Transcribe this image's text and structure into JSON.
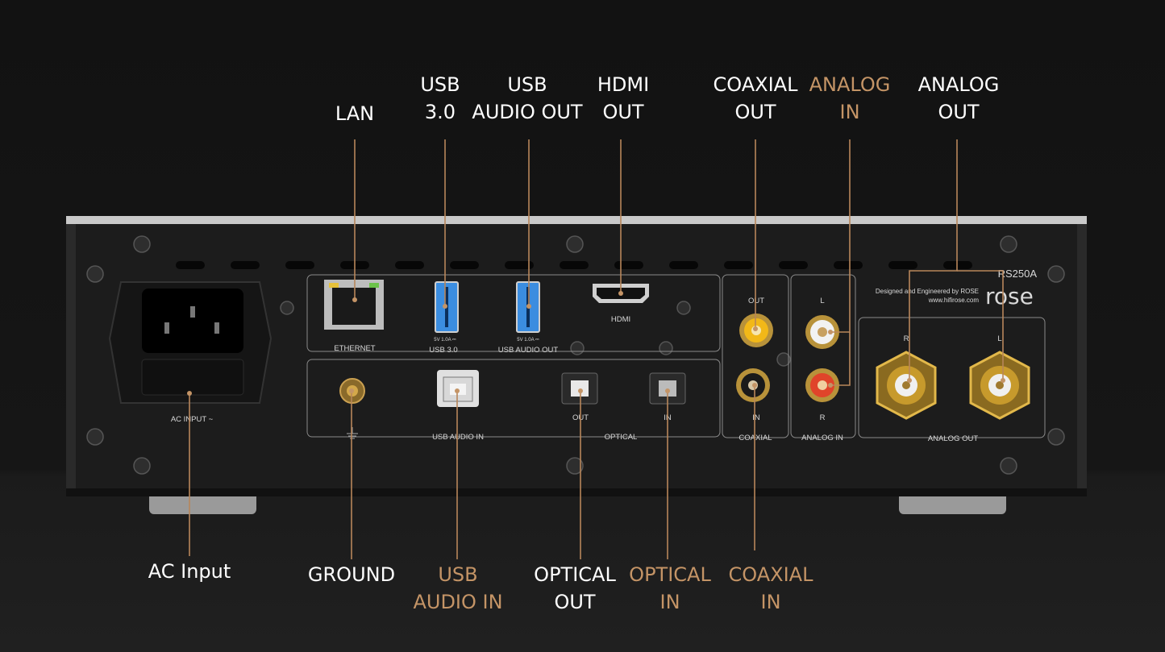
{
  "device": {
    "model": "RS250A",
    "brand": "rose",
    "tagline_1": "Designed and Engineered by ROSE",
    "tagline_2": "www.hifirose.com"
  },
  "panel_labels": {
    "ethernet": "ETHERNET",
    "usb3": "USB 3.0",
    "usb_audio_out": "USB AUDIO OUT",
    "usb_spec": "5V 1.0A ⎓",
    "hdmi": "HDMI",
    "out": "OUT",
    "in": "IN",
    "l": "L",
    "r": "R",
    "optical": "OPTICAL",
    "coaxial": "COAXIAL",
    "analog_in": "ANALOG IN",
    "analog_out": "ANALOG OUT",
    "usb_audio_in": "USB AUDIO IN",
    "ac_input": "AC INPUT ~"
  },
  "callouts": {
    "lan": [
      "LAN"
    ],
    "usb3": [
      "USB",
      "3.0"
    ],
    "usb_audio_out": [
      "USB",
      "AUDIO OUT"
    ],
    "hdmi_out": [
      "HDMI",
      "OUT"
    ],
    "coaxial_out": [
      "COAXIAL",
      "OUT"
    ],
    "analog_in": [
      "ANALOG",
      "IN"
    ],
    "analog_out": [
      "ANALOG",
      "OUT"
    ],
    "ac_input": [
      "AC Input"
    ],
    "ground": [
      "GROUND"
    ],
    "usb_audio_in": [
      "USB",
      "AUDIO IN"
    ],
    "optical_out": [
      "OPTICAL",
      "OUT"
    ],
    "optical_in": [
      "OPTICAL",
      "IN"
    ],
    "coaxial_in": [
      "COAXIAL",
      "IN"
    ]
  },
  "colors": {
    "output_label": "#ffffff",
    "input_label": "#c49466",
    "leader_line": "#b8865a",
    "chassis": "#1c1c1c"
  }
}
